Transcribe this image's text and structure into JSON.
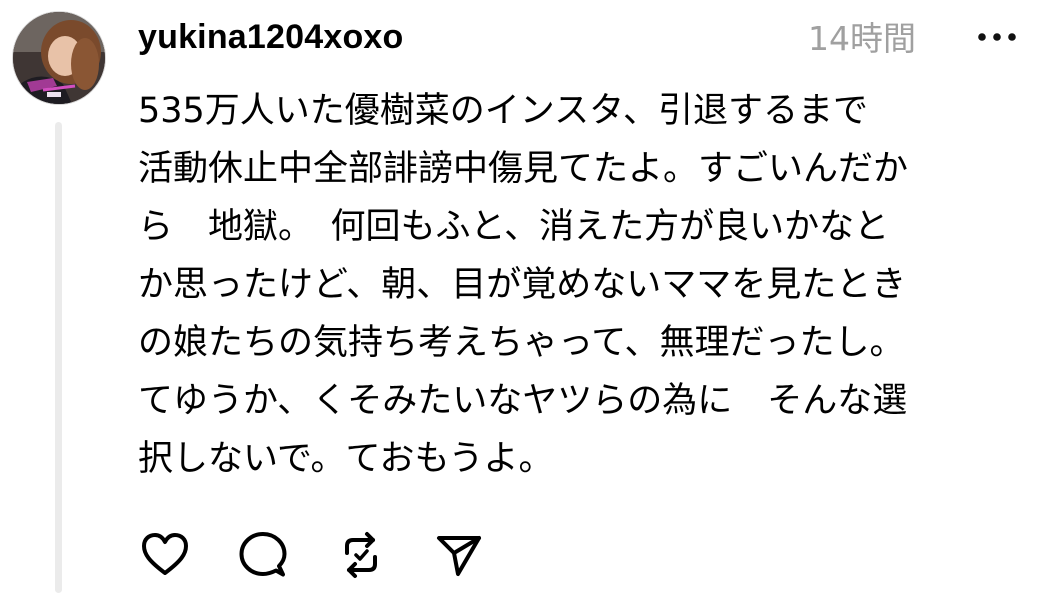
{
  "post": {
    "username": "yukina1204xoxo",
    "timestamp": "14時間",
    "body": "535万人いた優樹菜のインスタ、引退するまで\n活動休止中全部誹謗中傷見てたよ。すごいんだか\nら　地獄。　何回もふと、消えた方が良いかなと\nか思ったけど、朝、目が覚めないママを見たとき\nの娘たちの気持ち考えちゃって、無理だったし。\nてゆうか、くそみたいなヤツらの為に　そんな選\n択しないで。ておもうよ。"
  },
  "icons": {
    "avatar": "profile-photo",
    "more": "more-horizontal-icon",
    "like": "heart-icon",
    "reply": "comment-bubble-icon",
    "repost": "repost-icon",
    "share": "send-icon"
  },
  "colors": {
    "text": "#000000",
    "timestamp": "#a0a0a0",
    "thread_line": "#ebebeb",
    "background": "#ffffff"
  }
}
